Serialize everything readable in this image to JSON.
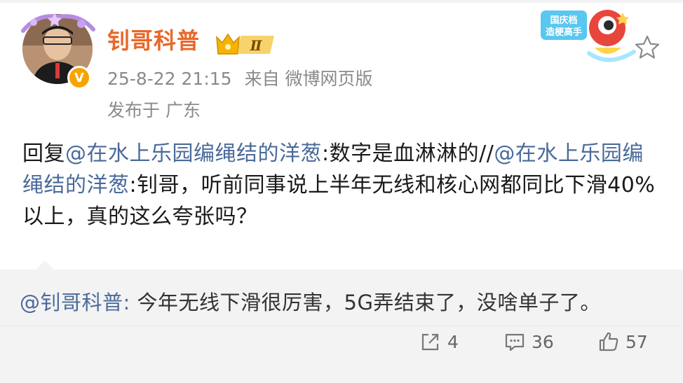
{
  "header": {
    "username": "钊哥科普",
    "level_badge": "Ⅱ",
    "verified_badge": "V",
    "timestamp": "25-8-22 21:15",
    "source": "来自 微博网页版",
    "location": "发布于 广东",
    "mascot_label": "国庆档\n造梗高手"
  },
  "post": {
    "prefix": "回复",
    "mention1": "@在水上乐园编绳结的洋葱",
    "text1": ":数字是血淋淋的//",
    "mention2": "@在水上乐园编绳结的洋葱",
    "text2": ":钊哥，听前同事说上半年无线和核心网都同比下滑40%以上，真的这么夸张吗？"
  },
  "quote": {
    "mention": "@钊哥科普:",
    "text": " 今年无线下滑很厉害，5G弄结束了，没啥单子了。"
  },
  "actions": {
    "repost_count": "4",
    "comment_count": "36",
    "like_count": "57"
  },
  "colors": {
    "username": "#e8682a",
    "mention": "#4a6a9a",
    "meta": "#8a8a8a",
    "quote_bg": "#f3f3f3"
  }
}
